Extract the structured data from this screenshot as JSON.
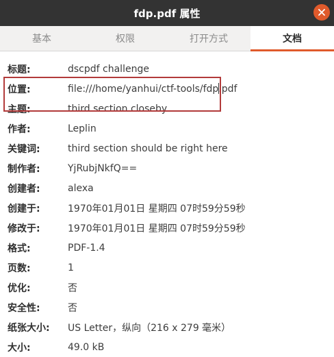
{
  "window": {
    "title": "fdp.pdf 属性",
    "close_icon": "close-icon",
    "accent_color": "#e05a2b"
  },
  "tabs": [
    {
      "label": "基本",
      "active": false
    },
    {
      "label": "权限",
      "active": false
    },
    {
      "label": "打开方式",
      "active": false
    },
    {
      "label": "文档",
      "active": true
    }
  ],
  "properties": [
    {
      "label": "标题:",
      "value": "dscpdf challenge"
    },
    {
      "label": "位置:",
      "value": "file:///home/yanhui/ctf-tools/fdp.pdf"
    },
    {
      "label": "主题:",
      "value": "third section closeby"
    },
    {
      "label": "作者:",
      "value": "Leplin"
    },
    {
      "label": "关键词:",
      "value": "third section should be right here"
    },
    {
      "label": "制作者:",
      "value": "YjRubjNkfQ=="
    },
    {
      "label": "创建者:",
      "value": "alexa"
    },
    {
      "label": "创建于:",
      "value": "1970年01月01日 星期四 07时59分59秒"
    },
    {
      "label": "修改于:",
      "value": "1970年01月01日 星期四 07时59分59秒"
    },
    {
      "label": "格式:",
      "value": "PDF-1.4"
    },
    {
      "label": "页数:",
      "value": "1"
    },
    {
      "label": "优化:",
      "value": "否"
    },
    {
      "label": "安全性:",
      "value": "否"
    },
    {
      "label": "纸张大小:",
      "value": "US Letter，纵向（216 x 279 毫米）"
    },
    {
      "label": "大小:",
      "value": "49.0 kB"
    }
  ],
  "highlight_color": "#b23a3a"
}
